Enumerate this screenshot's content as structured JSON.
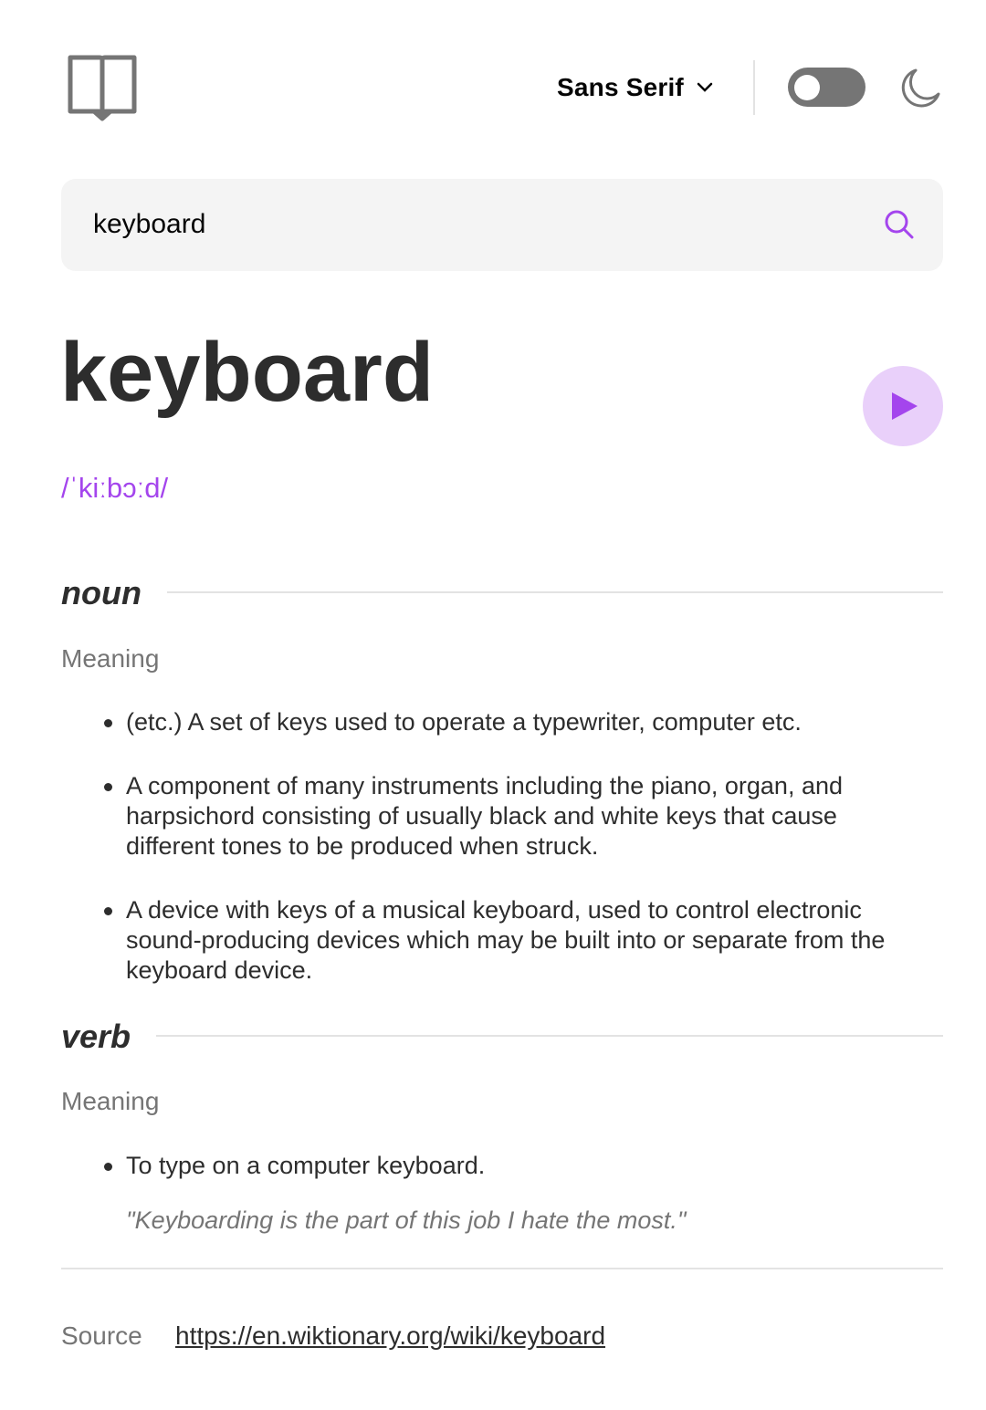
{
  "header": {
    "font_select_label": "Sans Serif"
  },
  "search": {
    "value": "keyboard"
  },
  "entry": {
    "word": "keyboard",
    "phonetic": "/ˈkiːbɔːd/",
    "meanings": [
      {
        "part_of_speech": "noun",
        "meaning_label": "Meaning",
        "definitions": [
          "(etc.) A set of keys used to operate a typewriter, computer etc.",
          "A component of many instruments including the piano, organ, and harpsichord consisting of usually black and white keys that cause different tones to be produced when struck.",
          "A device with keys of a musical keyboard, used to control electronic sound-producing devices which may be built into or separate from the keyboard device."
        ]
      },
      {
        "part_of_speech": "verb",
        "meaning_label": "Meaning",
        "definitions": [
          "To type on a computer keyboard."
        ],
        "example": "\"Keyboarding is the part of this job I hate the most.\""
      }
    ]
  },
  "source": {
    "label": "Source",
    "url": "https://en.wiktionary.org/wiki/keyboard"
  },
  "colors": {
    "accent": "#a445ed",
    "accent_light": "#e9d0fa",
    "text_dark": "#2d2d2d",
    "text_muted": "#757575",
    "toggle_bg": "#757575",
    "divider": "#e3e3e3",
    "search_bg": "#f4f4f4"
  },
  "icons": {
    "logo": "book-icon",
    "font_dropdown": "chevron-down-icon",
    "theme": "moon-icon",
    "search": "search-icon",
    "audio": "play-icon"
  }
}
